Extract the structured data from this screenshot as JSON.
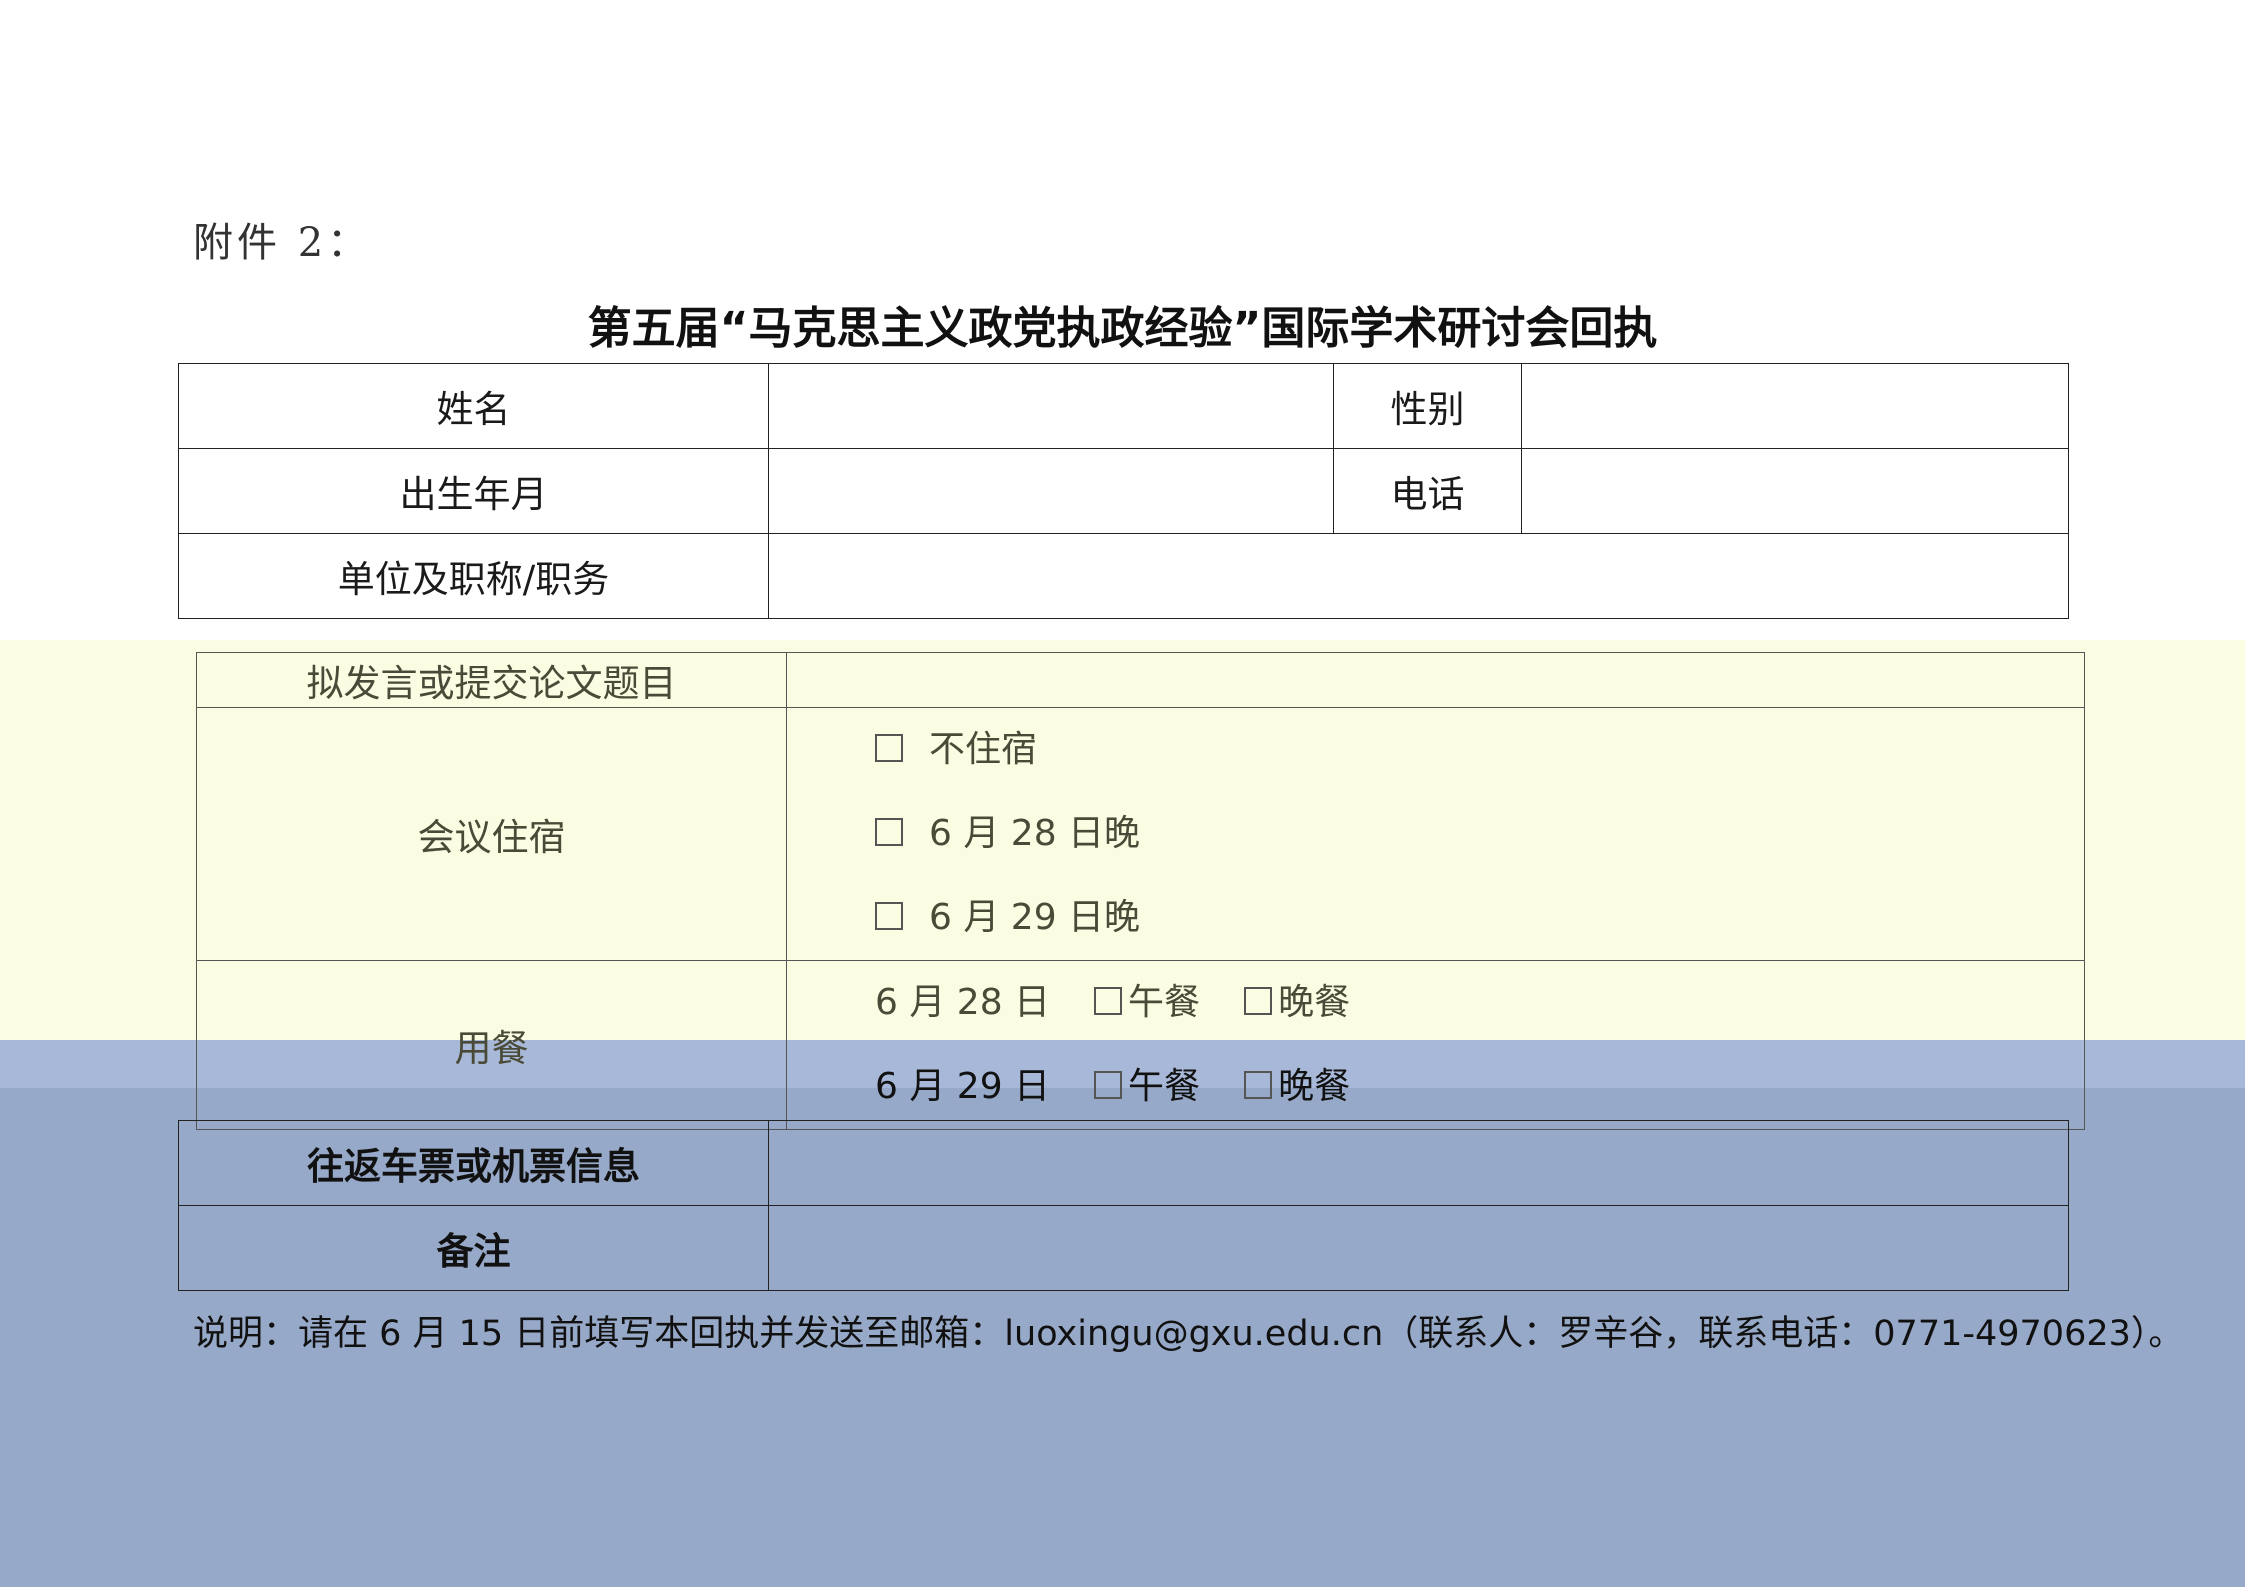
{
  "header": {
    "attachment": "附件 2：",
    "title": "第五届“马克思主义政党执政经验”国际学术研讨会回执"
  },
  "form": {
    "name_label": "姓名",
    "gender_label": "性别",
    "birth_label": "出生年月",
    "phone_label": "电话",
    "unit_label": "单位及职称/职务",
    "topic_label": "拟发言或提交论文题目",
    "lodging_label": "会议住宿",
    "lodging_options": [
      "不住宿",
      "6 月 28 日晚",
      "6 月 29 日晚"
    ],
    "meal_label": "用餐",
    "meal_rows": [
      {
        "date": "6 月 28 日",
        "lunch": "午餐",
        "dinner": "晚餐"
      },
      {
        "date": "6 月 29 日",
        "lunch": "午餐",
        "dinner": "晚餐"
      }
    ],
    "ticket_label": "往返车票或机票信息",
    "remark_label": "备注"
  },
  "note": "说明：请在 6 月 15 日前填写本回执并发送至邮箱：luoxingu@gxu.edu.cn（联系人：罗辛谷，联系电话：0771-4970623）。"
}
